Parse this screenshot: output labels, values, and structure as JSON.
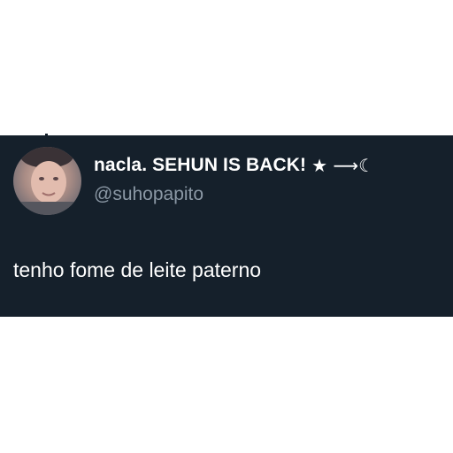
{
  "tweet": {
    "display_name": "nacla. SEHUN IS BACK!",
    "name_symbols": "★ ⟶☾",
    "handle": "@suhopapito",
    "text": "tenho fome de leite paterno"
  },
  "colors": {
    "card_background": "#15202b",
    "page_background": "#ffffff",
    "primary_text": "#ffffff",
    "secondary_text": "#8b98a5"
  }
}
